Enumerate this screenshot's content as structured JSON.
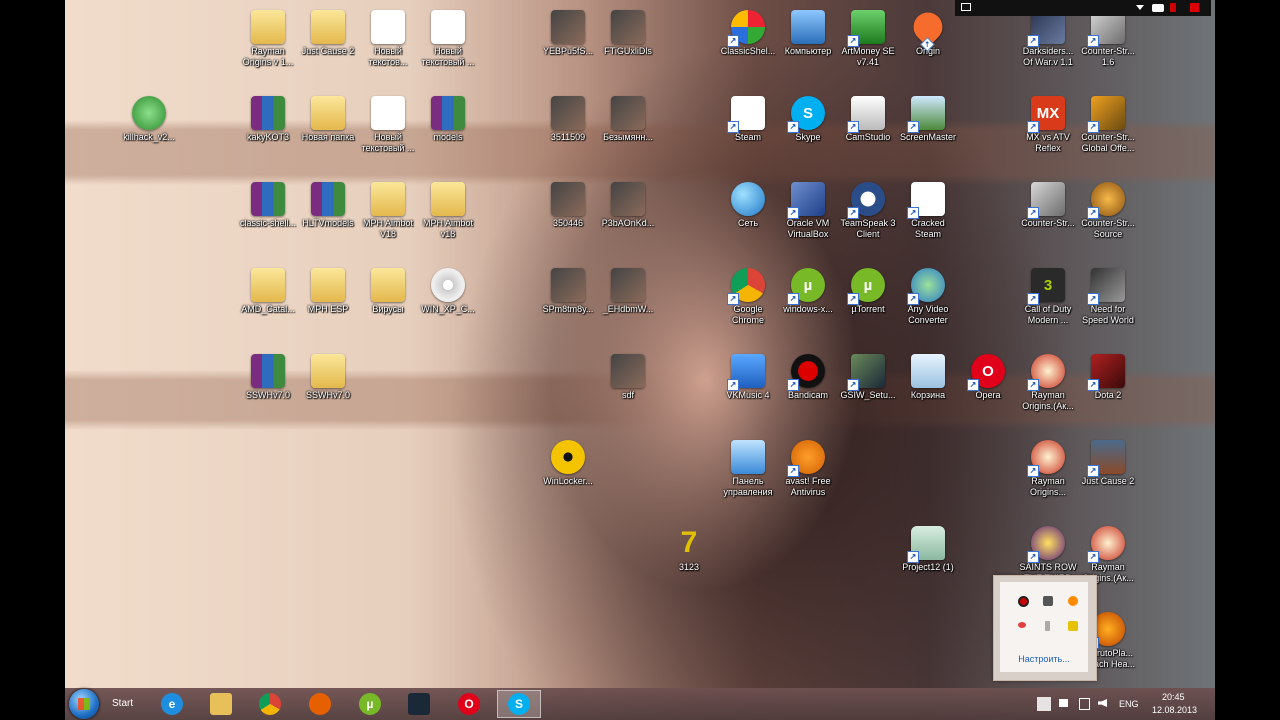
{
  "desktop": {
    "icons": [
      {
        "label": "Rayman Origins v 1...",
        "col": "c1",
        "row": "r0",
        "type": "folder"
      },
      {
        "label": "Just Cause 2",
        "col": "c2",
        "row": "r0",
        "type": "folder"
      },
      {
        "label": "Новый текстов...",
        "col": "c3",
        "row": "r0",
        "type": "doc"
      },
      {
        "label": "Новый текстовый ...",
        "col": "c4",
        "row": "r0",
        "type": "doc"
      },
      {
        "label": "killhack_v2...",
        "col": "c0",
        "row": "r1",
        "type": "alien"
      },
      {
        "label": "kakyKOT3",
        "col": "c1",
        "row": "r1",
        "type": "rar"
      },
      {
        "label": "Новая папка",
        "col": "c2",
        "row": "r1",
        "type": "folder"
      },
      {
        "label": "Новый текстовый ...",
        "col": "c3",
        "row": "r1",
        "type": "doc"
      },
      {
        "label": "models",
        "col": "c4",
        "row": "r1",
        "type": "rar"
      },
      {
        "label": "classic-shell...",
        "col": "c1",
        "row": "r2",
        "type": "rar"
      },
      {
        "label": "HLTVmodels",
        "col": "c2",
        "row": "r2",
        "type": "rar"
      },
      {
        "label": "MPH Aimbot V18",
        "col": "c3",
        "row": "r2",
        "type": "folder"
      },
      {
        "label": "MPH Aimbot v18",
        "col": "c4",
        "row": "r2",
        "type": "folder"
      },
      {
        "label": "AMD_Catal...",
        "col": "c1",
        "row": "r3",
        "type": "folder"
      },
      {
        "label": "MPH ESP",
        "col": "c2",
        "row": "r3",
        "type": "folder"
      },
      {
        "label": "Вирусы",
        "col": "c3",
        "row": "r3",
        "type": "folder"
      },
      {
        "label": "WIN_XP_C...",
        "col": "c4",
        "row": "r3",
        "type": "disc"
      },
      {
        "label": "SSWHv7.0",
        "col": "c1",
        "row": "r4",
        "type": "rar"
      },
      {
        "label": "SSWHv7.0",
        "col": "c2",
        "row": "r4",
        "type": "folder"
      },
      {
        "label": "YEBPu5fS...",
        "col": "c5",
        "row": "r0",
        "type": "img"
      },
      {
        "label": "FTiGUxliDls",
        "col": "c6",
        "row": "r0",
        "type": "img"
      },
      {
        "label": "3511509",
        "col": "c5",
        "row": "r1",
        "type": "img"
      },
      {
        "label": "Безымянн...",
        "col": "c6",
        "row": "r1",
        "type": "img"
      },
      {
        "label": "350446",
        "col": "c5",
        "row": "r2",
        "type": "img"
      },
      {
        "label": "P3bAOnKd...",
        "col": "c6",
        "row": "r2",
        "type": "img"
      },
      {
        "label": "SPm8tm8y...",
        "col": "c5",
        "row": "r3",
        "type": "img"
      },
      {
        "label": "_EHdbmW...",
        "col": "c6",
        "row": "r3",
        "type": "img"
      },
      {
        "label": "sdf",
        "col": "c6",
        "row": "r4",
        "type": "img"
      },
      {
        "label": "WinLocker...",
        "col": "c5",
        "row": "r5",
        "type": "radiation"
      },
      {
        "label": "3123",
        "col": "c7",
        "row": "r6",
        "type": "seven"
      },
      {
        "label": "ClassicShel...",
        "col": "c8",
        "row": "r0",
        "type": "shell"
      },
      {
        "label": "Компьютер",
        "col": "c9",
        "row": "r0",
        "type": "computer"
      },
      {
        "label": "ArtMoney SE v7.41",
        "col": "c10",
        "row": "r0",
        "type": "money"
      },
      {
        "label": "Origin",
        "col": "c11",
        "row": "r0",
        "type": "origin"
      },
      {
        "label": "Darksiders... Of War.v 1.1",
        "col": "c12",
        "row": "r0",
        "type": "game"
      },
      {
        "label": "Counter-Str... 1.6",
        "col": "c13",
        "row": "r0",
        "type": "cs"
      },
      {
        "label": "Steam",
        "col": "c8",
        "row": "r1",
        "type": "doc"
      },
      {
        "label": "Skype",
        "col": "c9",
        "row": "r1",
        "type": "skype"
      },
      {
        "label": "CamStudio",
        "col": "c10",
        "row": "r1",
        "type": "cam"
      },
      {
        "label": "ScreenMaster",
        "col": "c11",
        "row": "r1",
        "type": "screen"
      },
      {
        "label": "MX vs ATV Reflex",
        "col": "c12",
        "row": "r1",
        "type": "mx"
      },
      {
        "label": "Counter-Str... Global Offe...",
        "col": "c13",
        "row": "r1",
        "type": "csgo"
      },
      {
        "label": "Сеть",
        "col": "c8",
        "row": "r2",
        "type": "globe"
      },
      {
        "label": "Oracle VM VirtualBox",
        "col": "c9",
        "row": "r2",
        "type": "vbox"
      },
      {
        "label": "TeamSpeak 3 Client",
        "col": "c10",
        "row": "r2",
        "type": "ts"
      },
      {
        "label": "Cracked Steam",
        "col": "c11",
        "row": "r2",
        "type": "doc"
      },
      {
        "label": "Counter-Str...",
        "col": "c12",
        "row": "r2",
        "type": "cs"
      },
      {
        "label": "Counter-Str... Source",
        "col": "c13",
        "row": "r2",
        "type": "css"
      },
      {
        "label": "Google Chrome",
        "col": "c8",
        "row": "r3",
        "type": "chrome"
      },
      {
        "label": "windows-x...",
        "col": "c9",
        "row": "r3",
        "type": "utorrent"
      },
      {
        "label": "µTorrent",
        "col": "c10",
        "row": "r3",
        "type": "utorrent"
      },
      {
        "label": "Any Video Converter",
        "col": "c11",
        "row": "r3",
        "type": "avc"
      },
      {
        "label": "Call of Duty Modern ...",
        "col": "c12",
        "row": "r3",
        "type": "cod"
      },
      {
        "label": "Need for Speed World",
        "col": "c13",
        "row": "r3",
        "type": "nfs"
      },
      {
        "label": "VKMusic 4",
        "col": "c8",
        "row": "r4",
        "type": "vkm"
      },
      {
        "label": "Bandicam",
        "col": "c9",
        "row": "r4",
        "type": "bandi"
      },
      {
        "label": "GSIW_Setu...",
        "col": "c10",
        "row": "r4",
        "type": "steam"
      },
      {
        "label": "Корзина",
        "col": "c11",
        "row": "r4",
        "type": "bin"
      },
      {
        "label": "Opera",
        "col": "c12b",
        "row": "r4",
        "type": "opera"
      },
      {
        "label": "Rayman Origins.(Ак...",
        "col": "c12",
        "row": "r4",
        "type": "rayman"
      },
      {
        "label": "Dota 2",
        "col": "c13",
        "row": "r4",
        "type": "dota"
      },
      {
        "label": "Панель управления",
        "col": "c8",
        "row": "r5",
        "type": "panel"
      },
      {
        "label": "avast! Free Antivirus",
        "col": "c9",
        "row": "r5",
        "type": "avast"
      },
      {
        "label": "Rayman Origins...",
        "col": "c12",
        "row": "r5",
        "type": "rayman"
      },
      {
        "label": "Just Cause 2",
        "col": "c13",
        "row": "r5",
        "type": "jc2"
      },
      {
        "label": "Project12 (1)",
        "col": "c11b",
        "row": "r6",
        "type": "lock"
      },
      {
        "label": "SAINTS ROW THE THIRD",
        "col": "c12",
        "row": "r6",
        "type": "saints"
      },
      {
        "label": "Rayman Origins.(Ак...",
        "col": "c13",
        "row": "r6",
        "type": "rayman"
      },
      {
        "label": "[NarutoPla... Bleach Hea...",
        "col": "c13",
        "row": "r7",
        "type": "naruto"
      }
    ]
  },
  "taskbar": {
    "start_label": "Start",
    "apps": [
      "internet-explorer",
      "file-explorer",
      "google-chrome",
      "firefox",
      "utorrent",
      "steam",
      "opera",
      "skype"
    ],
    "language": "ENG",
    "time": "20:45",
    "date": "12.08.2013"
  },
  "tray_popup": {
    "customize_label": "Настроить..."
  },
  "colors": {
    "taskbar": "#6e5050",
    "link": "#1c5fbd",
    "popup_bg": "#f6f3f1"
  }
}
